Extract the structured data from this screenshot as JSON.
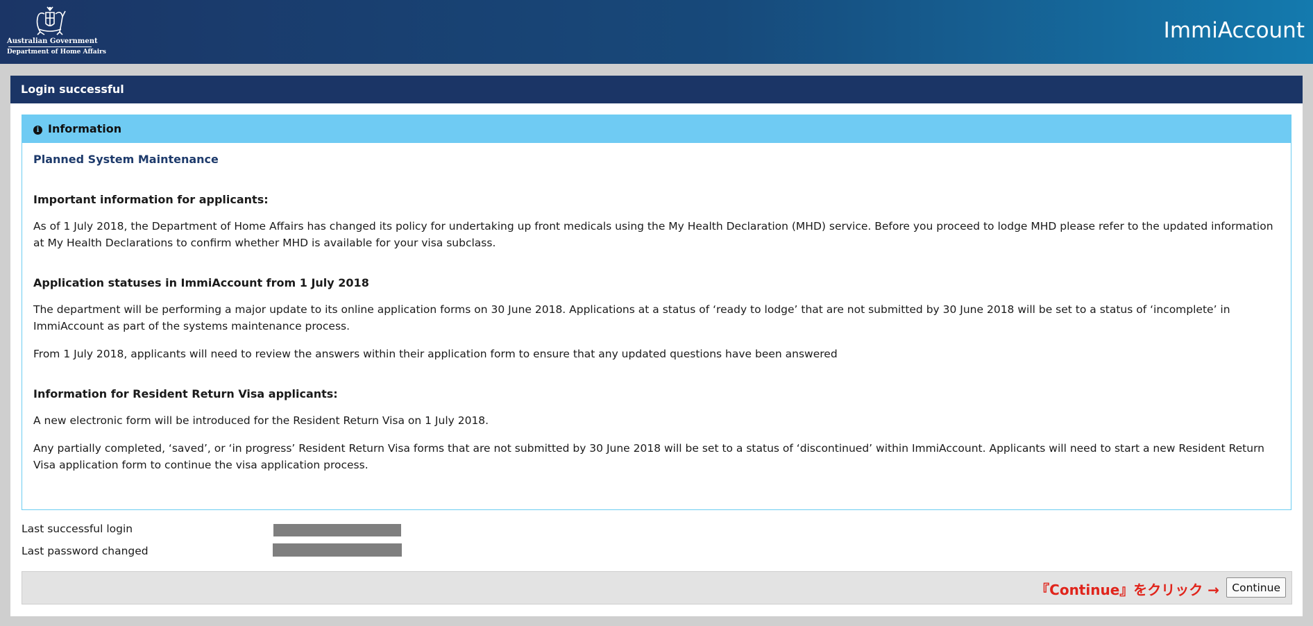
{
  "header": {
    "gov_name": "Australian Government",
    "dept_name": "Department of Home Affairs",
    "app_name": "ImmiAccount",
    "crest_icon": "coat-of-arms-icon"
  },
  "panel": {
    "title": "Login successful"
  },
  "info": {
    "heading": "Information",
    "icon": "info-icon",
    "maintenance_title": "Planned System Maintenance",
    "sections": [
      {
        "title": "Important information for applicants:",
        "paragraphs": [
          "As of 1 July 2018, the Department of Home Affairs has changed its policy for undertaking up front medicals using the My Health Declaration (MHD) service. Before you proceed to lodge MHD please refer to the updated information at My Health Declarations to confirm whether MHD is available for your visa subclass."
        ]
      },
      {
        "title": "Application statuses in ImmiAccount from 1 July 2018",
        "paragraphs": [
          "The department will be performing a major update to its online application forms on 30 June 2018.  Applications at a status of ‘ready to lodge’ that are not submitted by 30 June 2018  will be set to a status of ‘incomplete’ in ImmiAccount as part of the systems maintenance process.",
          "From 1 July 2018, applicants will need to review the answers within their application form to ensure that any updated questions have been answered"
        ]
      },
      {
        "title": "Information for Resident Return Visa applicants:",
        "paragraphs": [
          "A new electronic form will be introduced for the Resident Return Visa on 1 July 2018.",
          "Any partially completed, ‘saved’, or ‘in progress’ Resident Return Visa forms that are not submitted by 30 June 2018 will be set to a status of ‘discontinued’ within ImmiAccount. Applicants will need to start a new Resident Return Visa application form to continue the visa application process."
        ]
      }
    ]
  },
  "meta": {
    "last_login_label": "Last successful login",
    "last_password_label": "Last password changed"
  },
  "footer": {
    "note": "『Continue』をクリック →",
    "continue_label": "Continue"
  },
  "colors": {
    "header_dark": "#1b3566",
    "header_light": "#147aae",
    "info_bar": "#6fcbf3",
    "note_red": "#e0241b"
  }
}
